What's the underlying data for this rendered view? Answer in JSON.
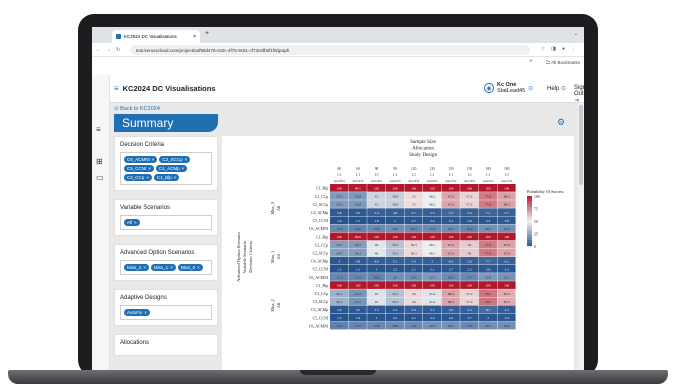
{
  "browser": {
    "tab_title": "KC2024 DC Visualisations",
    "tab_close": "×",
    "new_tab": "+",
    "url": "test.kerusscloud.com/project/a4f96d476-c02c-4f75-9c81-cf73c6fb0f1f8/graph",
    "bookmarks": "All Bookmarks"
  },
  "app": {
    "title": "KC2024 DC Visualisations",
    "user_name": "Kc One",
    "user_role": "StatLead45",
    "help": "Help",
    "signout": "Sign Out",
    "back": "Back to KC2024",
    "summary": "Summary"
  },
  "filters": {
    "decision_criteria": {
      "title": "Decision Criteria",
      "chips": [
        "C6_ACMNI",
        "C2_SCCp",
        "C5_CCNI",
        "C4_ACMp",
        "C2_CCp",
        "C1_Blp"
      ]
    },
    "variable_scenarios": {
      "title": "Variable Scenarios",
      "chips": [
        "All"
      ]
    },
    "advanced_options": {
      "title": "Advanced Option Scenarios",
      "chips": [
        "Miss_2",
        "Miss_1",
        "Miss_0"
      ]
    },
    "adaptive_designs": {
      "title": "Adaptive Designs",
      "chips": [
        "AutoFix"
      ]
    },
    "allocations": {
      "title": "Allocations"
    }
  },
  "chart_data": {
    "type": "heatmap",
    "top_label_lines": [
      "Sample Size",
      "Allocation",
      "Study Design"
    ],
    "sample_sizes": [
      "60",
      "60",
      "90",
      "90",
      "120",
      "120",
      "150",
      "150",
      "180",
      "180"
    ],
    "allocations": [
      "1:1",
      "1:1",
      "1:1",
      "1:1",
      "1:1",
      "1:1",
      "1:1",
      "1:1",
      "1:1",
      "1:1"
    ],
    "designs": [
      "AutoFix",
      "AutoFix",
      "AutoFix",
      "AutoFix",
      "AutoFix",
      "AutoFix",
      "AutoFix",
      "AutoFix",
      "AutoFix",
      "AutoFix"
    ],
    "y_axis_label": [
      "Advanced Option Scenario",
      "Variable Scenario",
      "Decision Criteria"
    ],
    "groups": [
      {
        "miss": "Miss_0",
        "scenario": "All",
        "rows": [
          "C1_Blp",
          "C2_CCp",
          "C2_SCCp",
          "C4_ACMp",
          "C5_CCNI",
          "C6_ACMNI"
        ],
        "values": [
          [
            100,
            99.5,
            100,
            100,
            100,
            100,
            100,
            100,
            100,
            100
          ],
          [
            23.5,
            22.8,
            41.0,
            39.6,
            55,
            48.2,
            67.6,
            57.2,
            77.6,
            68.5
          ],
          [
            23.5,
            22.8,
            41.0,
            39.6,
            55,
            48.2,
            67.6,
            57.2,
            77.6,
            68.5
          ],
          [
            3.8,
            3.6,
            5.4,
            4.8,
            5.7,
            5.5,
            7.5,
            5.4,
            7.1,
            5.7
          ],
          [
            1.9,
            1.5,
            1.8,
            2,
            2.7,
            2.4,
            3.1,
            2.8,
            2.3,
            3.9
          ],
          [
            17.6,
            16.6,
            17.8,
            19.5,
            18.3,
            17.9,
            19.1,
            16.9,
            20.3,
            19.9
          ]
        ]
      },
      {
        "miss": "Miss_1",
        "scenario": "All",
        "rows": [
          "C1_Blp",
          "C2_CCp",
          "C2_SCCp",
          "C4_ACMp",
          "C5_CCNI",
          "C6_ACMNI"
        ],
        "values": [
          [
            100,
            99.6,
            100,
            100,
            100,
            100,
            100,
            100,
            100,
            100
          ],
          [
            24.7,
            24.2,
            46.0,
            35.5,
            56.3,
            48.1,
            67.6,
            59,
            77.6,
            67.8
          ],
          [
            24.7,
            24.2,
            46.0,
            35.5,
            56.3,
            48.1,
            67.6,
            59,
            77.6,
            67.8
          ],
          [
            3,
            3.8,
            4.9,
            5.1,
            5.4,
            5,
            6.3,
            5.6,
            7.7,
            6.1
          ],
          [
            1.3,
            1.2,
            2,
            2.2,
            2.1,
            2.1,
            2.7,
            2.2,
            2.8,
            2.3
          ],
          [
            17.4,
            17.2,
            16.6,
            20,
            19.6,
            22.5,
            18.4,
            17.7,
            22.8,
            21.1
          ]
        ]
      },
      {
        "miss": "Miss_2",
        "scenario": "All",
        "rows": [
          "C1_Blp",
          "C2_CCp",
          "C2_SCCp",
          "C4_ACMp",
          "C5_CCNI",
          "C6_ACMNI"
        ],
        "values": [
          [
            100,
            100,
            100,
            100,
            100,
            100,
            100,
            100,
            100,
            100
          ],
          [
            30.1,
            21.2,
            45,
            35.2,
            56,
            45.4,
            68.4,
            57.2,
            78.7,
            65.9
          ],
          [
            30.1,
            21.2,
            45,
            35.2,
            56,
            45.4,
            68.4,
            57.2,
            78.7,
            65.9
          ],
          [
            2.6,
            3.5,
            3.5,
            2.4,
            5.5,
            3.5,
            5.6,
            5.4,
            9.1,
            4.5
          ],
          [
            1.5,
            1.8,
            2,
            2.2,
            2.1,
            2.4,
            2.6,
            2.7,
            3,
            3.4
          ],
          [
            15.5,
            17.2,
            17.8,
            18.8,
            18,
            20.5,
            20.2,
            17.9,
            20.1,
            19.6
          ]
        ]
      }
    ],
    "legend_title": "Probability Of Success",
    "legend_ticks": [
      "100",
      "75",
      "50",
      "25",
      "0"
    ],
    "colors": {
      "low": "#1f4e8c",
      "mid": "#f2f2f2",
      "high": "#b2182b"
    }
  },
  "icons": [
    "menu-icon",
    "grid-icon",
    "folder-icon",
    "settings-icon",
    "gear-icon",
    "user-icon"
  ]
}
